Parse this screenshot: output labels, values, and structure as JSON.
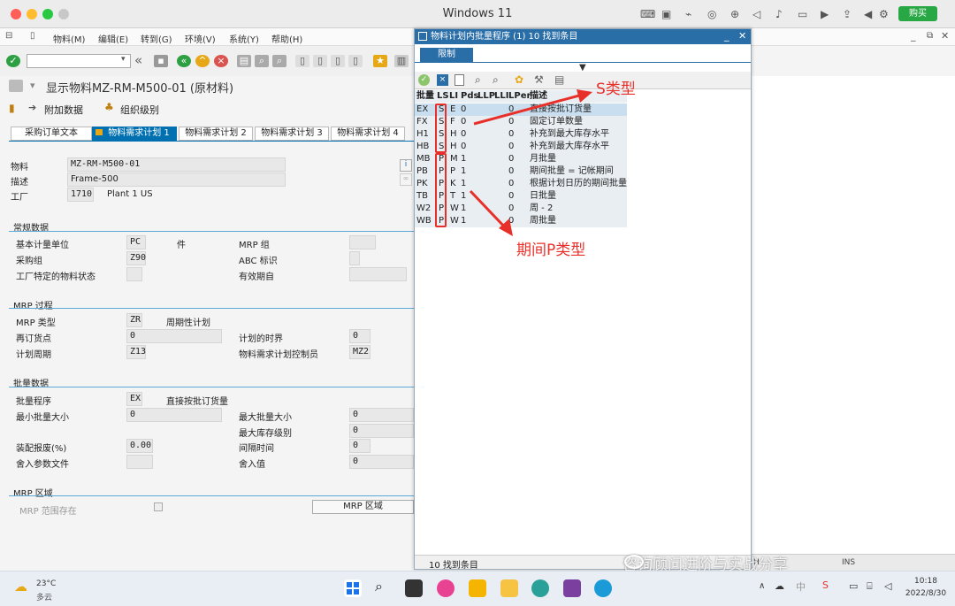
{
  "mac": {
    "title": "Windows 11",
    "buy_label": "购买"
  },
  "sap": {
    "menu": [
      "物料(M)",
      "编辑(E)",
      "转到(G)",
      "环境(V)",
      "系统(Y)",
      "帮助(H)"
    ],
    "page_title": "显示物料MZ-RM-M500-01 (原材料)",
    "subtoolbar": {
      "additional_data": "附加数据",
      "org_levels": "组织级别"
    },
    "tabs": [
      "采购订单文本",
      "物料需求计划 1",
      "物料需求计划 2",
      "物料需求计划 3",
      "物料需求计划 4"
    ],
    "header": {
      "material_label": "物料",
      "material_value": "MZ-RM-M500-01",
      "desc_label": "描述",
      "desc_value": "Frame-500",
      "plant_label": "工厂",
      "plant_value": "1710",
      "plant_name": "Plant 1 US"
    },
    "general": {
      "title": "常规数据",
      "base_unit_label": "基本计量单位",
      "base_unit_value": "PC",
      "base_unit_text": "件",
      "mrp_group_label": "MRP 组",
      "purch_group_label": "采购组",
      "purch_group_value": "Z90",
      "abc_label": "ABC 标识",
      "plant_status_label": "工厂特定的物料状态",
      "valid_from_label": "有效期自"
    },
    "mrp_proc": {
      "title": "MRP 过程",
      "mrp_type_label": "MRP 类型",
      "mrp_type_value": "ZR",
      "mrp_type_text": "周期性计划",
      "reorder_label": "再订货点",
      "reorder_value": "0",
      "planning_horizon_label": "计划的时界",
      "planning_horizon_value": "0",
      "planning_cycle_label": "计划周期",
      "planning_cycle_value": "Z13",
      "controller_label": "物料需求计划控制员",
      "controller_value": "MZ2"
    },
    "lot": {
      "title": "批量数据",
      "lot_proc_label": "批量程序",
      "lot_proc_value": "EX",
      "lot_proc_text": "直接按批订货量",
      "min_lot_label": "最小批量大小",
      "min_lot_value": "0",
      "max_lot_label": "最大批量大小",
      "max_lot_value": "0",
      "max_stock_label": "最大库存级别",
      "max_stock_value": "0",
      "scrap_label": "装配报废(%)",
      "scrap_value": "0.00",
      "interval_label": "间隔时间",
      "interval_value": "0",
      "rounding_profile_label": "舍入参数文件",
      "rounding_value_label": "舍入值",
      "rounding_value_value": "0"
    },
    "mrp_area": {
      "title": "MRP 区域",
      "exists_label": "MRP 范围存在",
      "button_label": "MRP 区域"
    }
  },
  "popup": {
    "title": "物料计划内批量程序 (1)   10 找到条目",
    "tab": "限制",
    "columns": [
      "批量",
      "LS",
      "LI",
      "Pds",
      "LLP",
      "LLI",
      "LPer",
      "描述"
    ],
    "rows": [
      {
        "k": "EX",
        "ls": "S",
        "li": "E",
        "pds": "0",
        "llp": "0",
        "desc": "直接按批订货量"
      },
      {
        "k": "FX",
        "ls": "S",
        "li": "F",
        "pds": "0",
        "llp": "0",
        "desc": "固定订单数量"
      },
      {
        "k": "H1",
        "ls": "S",
        "li": "H",
        "pds": "0",
        "llp": "0",
        "desc": "补充到最大库存水平"
      },
      {
        "k": "HB",
        "ls": "S",
        "li": "H",
        "pds": "0",
        "llp": "0",
        "desc": "补充到最大库存水平"
      },
      {
        "k": "MB",
        "ls": "P",
        "li": "M",
        "pds": "1",
        "llp": "0",
        "desc": "月批量"
      },
      {
        "k": "PB",
        "ls": "P",
        "li": "P",
        "pds": "1",
        "llp": "0",
        "desc": "期间批量 = 记帐期间"
      },
      {
        "k": "PK",
        "ls": "P",
        "li": "K",
        "pds": "1",
        "llp": "0",
        "desc": "根据计划日历的期间批量"
      },
      {
        "k": "TB",
        "ls": "P",
        "li": "T",
        "pds": "1",
        "llp": "0",
        "desc": "日批量"
      },
      {
        "k": "W2",
        "ls": "P",
        "li": "W",
        "pds": "1",
        "llp": "0",
        "desc": "周 - 2"
      },
      {
        "k": "WB",
        "ls": "P",
        "li": "W",
        "pds": "1",
        "llp": "0",
        "desc": "周批量"
      }
    ],
    "footer": "10 找到条目"
  },
  "annotations": {
    "s_type": "S类型",
    "p_type": "期间P类型"
  },
  "status_bar": {
    "insert_mode": "INS"
  },
  "watermark": "咨询顾问进阶与实战分享",
  "taskbar": {
    "weather_temp": "23°C",
    "weather_desc": "多云",
    "time": "10:18",
    "date": "2022/8/30"
  },
  "colors": {
    "accent": "#0070b0",
    "annotation": "#e8302a",
    "buy": "#28a745"
  }
}
